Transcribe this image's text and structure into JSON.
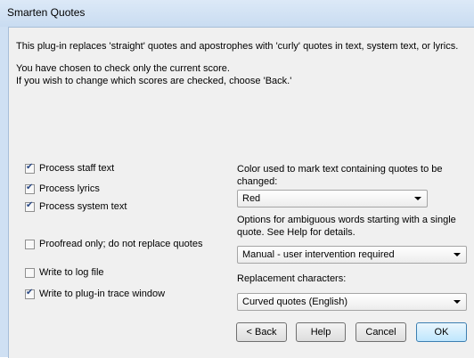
{
  "window": {
    "title": "Smarten Quotes"
  },
  "intro": {
    "line1": "This plug-in replaces 'straight' quotes and apostrophes with 'curly' quotes in text, system text, or lyrics.",
    "line2": "You have chosen to check only the current score.",
    "line3": "If you wish to change which scores are checked, choose 'Back.'"
  },
  "options": {
    "process_staff_text": {
      "label": "Process staff text",
      "checked": true
    },
    "process_lyrics": {
      "label": "Process lyrics",
      "checked": true
    },
    "process_system_text": {
      "label": "Process system text",
      "checked": true
    },
    "proofread_only": {
      "label": "Proofread only; do not replace quotes",
      "checked": false
    },
    "write_log": {
      "label": "Write to log file",
      "checked": false
    },
    "write_trace": {
      "label": "Write to plug-in trace window",
      "checked": true
    }
  },
  "color": {
    "label": "Color used to mark text containing quotes to be changed:",
    "selected": "Red"
  },
  "ambiguous": {
    "label": "Options for ambiguous words starting with a single quote. See Help for details.",
    "selected": "Manual - user intervention required"
  },
  "replacement": {
    "label": "Replacement characters:",
    "selected": "Curved quotes (English)"
  },
  "buttons": {
    "back": "< Back",
    "help": "Help",
    "cancel": "Cancel",
    "ok": "OK"
  }
}
